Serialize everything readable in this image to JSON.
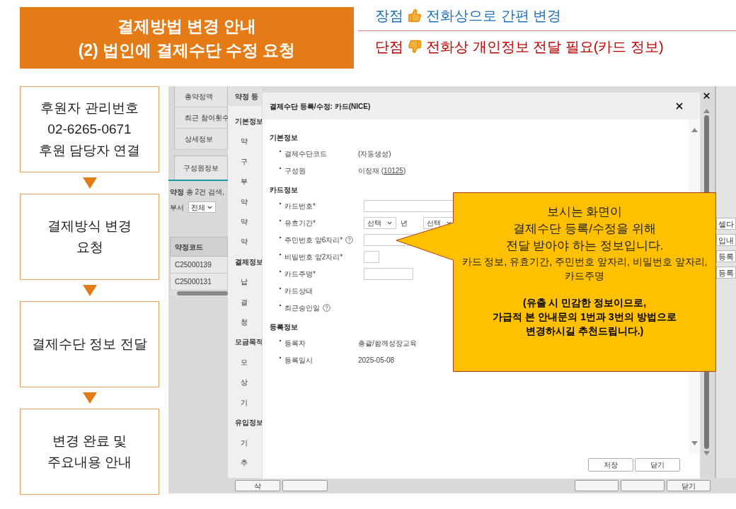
{
  "title_box": {
    "lines": [
      "결제방법 변경 안내",
      "(2) 법인에 결제수단 수정 요청"
    ]
  },
  "pros_cons": [
    {
      "kind": "pro",
      "label": "장점",
      "text": "전화상으로 간편 변경"
    },
    {
      "kind": "con",
      "label": "단점",
      "text": "전화상 개인정보 전달 필요(카드 정보)"
    }
  ],
  "flow_steps": [
    {
      "lines": [
        "후원자 관리번호",
        "02-6265-0671",
        "후원 담당자 연결"
      ]
    },
    {
      "lines": [
        "결제방식 변경",
        "요청"
      ]
    },
    {
      "lines": [
        "결제수단 정보 전달"
      ]
    },
    {
      "lines": [
        "변경 완료 및",
        "주요내용 안내"
      ]
    }
  ],
  "background_app": {
    "tabs": [
      "총약정액",
      "최근 참여횟수",
      "상세정보"
    ],
    "sub_tab": {
      "label": "구성원정보",
      "selected": true
    },
    "summary": "**약정** 총 2건 검색,",
    "filter": {
      "label": "부서",
      "value": "전체"
    },
    "table": {
      "columns": [
        "약정코드"
      ],
      "rows": [
        [
          "C25000139"
        ],
        [
          "C25000131"
        ]
      ]
    },
    "panel_header": "약정 등",
    "panel_items": [
      {
        "kind": "section",
        "text": "기본정보"
      },
      {
        "kind": "field",
        "text": "약"
      },
      {
        "kind": "field",
        "text": "구"
      },
      {
        "kind": "field",
        "text": "부"
      },
      {
        "kind": "field",
        "text": "약"
      },
      {
        "kind": "field",
        "text": "약"
      },
      {
        "kind": "field",
        "text": "약"
      },
      {
        "kind": "section",
        "text": "결제정보"
      },
      {
        "kind": "field",
        "text": "납"
      },
      {
        "kind": "field",
        "text": "결"
      },
      {
        "kind": "field",
        "text": "청"
      },
      {
        "kind": "section",
        "text": "모금목적"
      },
      {
        "kind": "field",
        "text": "모"
      },
      {
        "kind": "field",
        "text": "상"
      },
      {
        "kind": "field",
        "text": "기"
      },
      {
        "kind": "section",
        "text": "유입정보"
      },
      {
        "kind": "field",
        "text": "기"
      },
      {
        "kind": "field",
        "text": "추"
      }
    ],
    "right_buttons": [
      "셀다",
      "입내",
      "등록",
      "등록"
    ],
    "bottom_buttons_left": [
      {
        "kind": "label",
        "text": "삭"
      },
      {
        "kind": "covered"
      }
    ],
    "bottom_buttons_right": [
      {
        "kind": "covered"
      },
      {
        "kind": "covered"
      },
      {
        "kind": "label",
        "text": "닫기"
      }
    ]
  },
  "dialog": {
    "title": "결제수단 등록/수정: 카드(NICE)",
    "sections": [
      {
        "title": "기본정보",
        "fields": [
          {
            "label": "결제수단코드",
            "kind": "text",
            "value": "(자동생성)"
          },
          {
            "label": "구성원",
            "kind": "person",
            "value": "이정재",
            "link": "(10125)"
          }
        ]
      },
      {
        "title": "카드정보",
        "fields": [
          {
            "label": "카드번호*",
            "kind": "long_input"
          },
          {
            "label": "유효기간*",
            "kind": "date_select",
            "selects": [
              {
                "value": "선택",
                "unit": "년"
              },
              {
                "value": "선택"
              }
            ]
          },
          {
            "label": "주민번호 앞6자리*",
            "kind": "medium_input",
            "help": true
          },
          {
            "label": "비밀번호 앞2자리*",
            "kind": "tiny_input"
          },
          {
            "label": "카드주명*",
            "kind": "short_input"
          },
          {
            "label": "카드상태",
            "kind": "none"
          },
          {
            "label": "최근승인일",
            "kind": "none",
            "help": true
          }
        ]
      },
      {
        "title": "등록정보",
        "fields": [
          {
            "label": "등록자",
            "kind": "text",
            "value": "총괄/함께성장교육"
          },
          {
            "label": "등록일시",
            "kind": "text",
            "value": "2025-05-08"
          }
        ]
      }
    ],
    "buttons": [
      "저장",
      "닫기"
    ]
  },
  "callout": {
    "main_lines": [
      "보시는 화면이",
      "결제수단 등록/수정을 위해",
      "전달 받아야 하는 정보입니다."
    ],
    "detail": "카드 정보, 유효기간, 주민번호 앞자리, 비밀번호 앞자리, 카드주명",
    "note_lines": [
      "(유출 시 민감한 정보이므로,",
      "가급적 본 안내문의 1번과 3번의 방법으로",
      "변경하시길 추천드립니다.)"
    ]
  }
}
